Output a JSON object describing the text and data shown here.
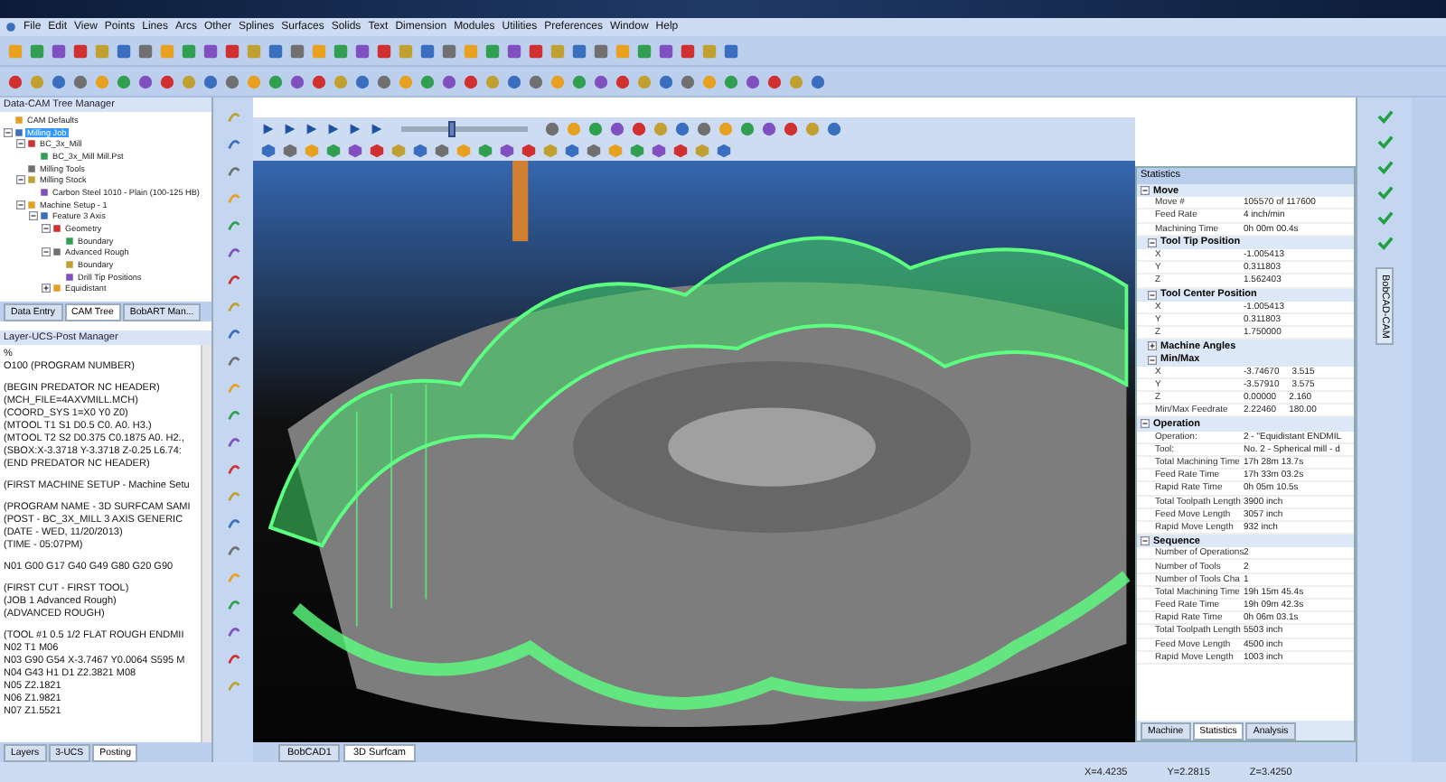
{
  "menu": [
    "File",
    "Edit",
    "View",
    "Points",
    "Lines",
    "Arcs",
    "Other",
    "Splines",
    "Surfaces",
    "Solids",
    "Text",
    "Dimension",
    "Modules",
    "Utilities",
    "Preferences",
    "Window",
    "Help"
  ],
  "tree_panel": {
    "title": "Data-CAM Tree Manager",
    "items": [
      {
        "label": "CAM Defaults",
        "selected": false
      },
      {
        "label": "Milling Job",
        "selected": true,
        "expanded": true,
        "children": [
          {
            "label": "BC_3x_Mill",
            "selected": false,
            "expanded": true,
            "children": [
              {
                "label": "BC_3x_Mill Mill.Pst",
                "selected": false
              }
            ]
          },
          {
            "label": "Milling Tools",
            "selected": false
          },
          {
            "label": "Milling Stock",
            "selected": false,
            "expanded": true,
            "children": [
              {
                "label": "Carbon Steel 1010 - Plain (100-125 HB)",
                "selected": false
              }
            ]
          },
          {
            "label": "Machine Setup - 1",
            "selected": false,
            "expanded": true,
            "children": [
              {
                "label": "Feature 3 Axis",
                "selected": false,
                "expanded": true,
                "children": [
                  {
                    "label": "Geometry",
                    "selected": false,
                    "expanded": true,
                    "children": [
                      {
                        "label": "Boundary",
                        "selected": false
                      }
                    ]
                  },
                  {
                    "label": "Advanced Rough",
                    "selected": false,
                    "expanded": true,
                    "children": [
                      {
                        "label": "Boundary",
                        "selected": false
                      },
                      {
                        "label": "Drill Tip Positions",
                        "selected": false
                      }
                    ]
                  },
                  {
                    "label": "Equidistant",
                    "selected": false,
                    "expanded": false
                  }
                ]
              }
            ]
          }
        ]
      }
    ],
    "tabs": [
      {
        "label": "Data Entry",
        "selected": false
      },
      {
        "label": "CAM Tree",
        "selected": true
      },
      {
        "label": "BobART Man...",
        "selected": false
      }
    ]
  },
  "code_panel": {
    "title": "Layer-UCS-Post Manager",
    "blocks": [
      [
        "%",
        "O100 (PROGRAM NUMBER)"
      ],
      [
        "(BEGIN PREDATOR NC HEADER)",
        "(MCH_FILE=4AXVMILL.MCH)",
        "(COORD_SYS 1=X0 Y0 Z0)",
        "(MTOOL T1 S1 D0.5 C0. A0. H3.)",
        "(MTOOL T2 S2 D0.375 C0.1875 A0. H2.,",
        "(SBOX:X-3.3718 Y-3.3718 Z-0.25 L6.74:",
        "(END PREDATOR NC HEADER)"
      ],
      [
        "(FIRST MACHINE SETUP - Machine Setu"
      ],
      [
        "(PROGRAM NAME - 3D SURFCAM SAMI",
        "(POST - BC_3X_MILL 3 AXIS GENERIC",
        "(DATE - WED, 11/20/2013)",
        "(TIME - 05:07PM)"
      ],
      [
        "N01 G00 G17 G40 G49 G80 G20 G90"
      ],
      [
        "(FIRST CUT - FIRST TOOL)",
        "(JOB 1 Advanced Rough)",
        "(ADVANCED ROUGH)"
      ],
      [
        "(TOOL #1 0.5  1/2 FLAT ROUGH ENDMII",
        "N02 T1 M06",
        "N03 G90 G54 X-3.7467 Y0.0064 S595 M",
        "N04 G43 H1 D1 Z2.3821 M08",
        "N05 Z2.1821",
        "N06 Z1.9821",
        "N07 Z1.5521"
      ]
    ],
    "tabs": [
      {
        "label": "Layers",
        "selected": false
      },
      {
        "label": "3-UCS",
        "selected": false
      },
      {
        "label": "Posting",
        "selected": true
      }
    ]
  },
  "viewport": {
    "slider": {
      "level": 0.4
    }
  },
  "statistics": {
    "title": "Statistics",
    "sections": [
      {
        "label": "Move",
        "expanded": true,
        "items": [
          {
            "kind": "row",
            "name": "Move #",
            "values": [
              "105570 of 117600"
            ]
          },
          {
            "kind": "row",
            "name": "Feed Rate",
            "values": [
              "4 inch/min"
            ]
          },
          {
            "kind": "row",
            "name": "Machining Time",
            "values": [
              "0h 00m 00.4s"
            ]
          },
          {
            "kind": "group",
            "label": "Tool Tip Position",
            "expanded": true,
            "rows": [
              {
                "name": "X",
                "values": [
                  "-1.005413"
                ]
              },
              {
                "name": "Y",
                "values": [
                  "0.311803"
                ]
              },
              {
                "name": "Z",
                "values": [
                  "1.562403"
                ]
              }
            ]
          },
          {
            "kind": "group",
            "label": "Tool Center Position",
            "expanded": true,
            "rows": [
              {
                "name": "X",
                "values": [
                  "-1.005413"
                ]
              },
              {
                "name": "Y",
                "values": [
                  "0.311803"
                ]
              },
              {
                "name": "Z",
                "values": [
                  "1.750000"
                ]
              }
            ]
          },
          {
            "kind": "group",
            "label": "Machine Angles",
            "expanded": false
          },
          {
            "kind": "group",
            "label": "Min/Max",
            "expanded": true,
            "rows": [
              {
                "name": "X",
                "values": [
                  "-3.74670",
                  "3.515"
                ]
              },
              {
                "name": "Y",
                "values": [
                  "-3.57910",
                  "3.575"
                ]
              },
              {
                "name": "Z",
                "values": [
                  "0.00000",
                  "2.160"
                ]
              },
              {
                "name": "Min/Max Feedrate",
                "values": [
                  "2.22460",
                  "180.00"
                ]
              }
            ]
          }
        ]
      },
      {
        "label": "Operation",
        "expanded": true,
        "items": [
          {
            "kind": "row",
            "name": "Operation:",
            "values": [
              "2 - \"Equidistant ENDMIL"
            ]
          },
          {
            "kind": "row",
            "name": "Tool:",
            "values": [
              "No. 2 - Spherical mill - d"
            ]
          },
          {
            "kind": "row",
            "name": "Total Machining Time",
            "values": [
              "17h 28m 13.7s"
            ]
          },
          {
            "kind": "row",
            "name": "Feed Rate Time",
            "values": [
              "17h 33m 03.2s"
            ]
          },
          {
            "kind": "row",
            "name": "Rapid Rate Time",
            "values": [
              "0h 05m 10.5s"
            ]
          },
          {
            "kind": "row",
            "name": "Total Toolpath Length",
            "values": [
              "3900 inch"
            ]
          },
          {
            "kind": "row",
            "name": "Feed Move Length",
            "values": [
              "3057 inch"
            ]
          },
          {
            "kind": "row",
            "name": "Rapid Move Length",
            "values": [
              "932 inch"
            ]
          }
        ]
      },
      {
        "label": "Sequence",
        "expanded": true,
        "items": [
          {
            "kind": "row",
            "name": "Number of Operations",
            "values": [
              "2"
            ]
          },
          {
            "kind": "row",
            "name": "Number of Tools",
            "values": [
              "2"
            ]
          },
          {
            "kind": "row",
            "name": "Number of Tools Cha",
            "values": [
              "1"
            ]
          },
          {
            "kind": "row",
            "name": "Total Machining Time",
            "values": [
              "19h 15m 45.4s"
            ]
          },
          {
            "kind": "row",
            "name": "Feed Rate Time",
            "values": [
              "19h 09m 42.3s"
            ]
          },
          {
            "kind": "row",
            "name": "Rapid Rate Time",
            "values": [
              "0h 06m 03.1s"
            ]
          },
          {
            "kind": "row",
            "name": "Total Toolpath Length",
            "values": [
              "5503 inch"
            ]
          },
          {
            "kind": "row",
            "name": "Feed Move Length",
            "values": [
              "4500 inch"
            ]
          },
          {
            "kind": "row",
            "name": "Rapid Move Length",
            "values": [
              "1003 inch"
            ]
          }
        ]
      }
    ],
    "tabs": [
      {
        "label": "Machine",
        "selected": false
      },
      {
        "label": "Statistics",
        "selected": true
      },
      {
        "label": "Analysis",
        "selected": false
      }
    ]
  },
  "document_tabs": [
    {
      "label": "BobCAD1",
      "selected": false
    },
    {
      "label": "3D Surfcam",
      "selected": true
    }
  ],
  "side_tab": "BobCAD-CAM",
  "status_bar": {
    "coordinates": [
      "X=4.4235",
      "Y=2.2815",
      "Z=3.4250"
    ]
  }
}
